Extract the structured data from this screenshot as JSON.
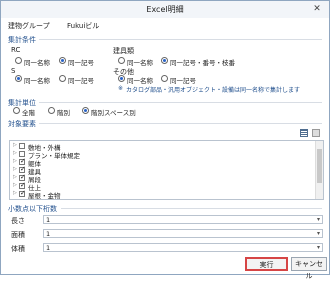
{
  "window": {
    "title": "Excel明細",
    "close_glyph": "✕"
  },
  "info": {
    "group": "建物グループ",
    "name": "Fukuiビル"
  },
  "sections": {
    "conditions": "集計条件",
    "unit": "集計単位",
    "elements": "対象要素",
    "decimals": "小数点以下桁数"
  },
  "conditions": {
    "rc": {
      "label": "RC",
      "options": [
        "同一名称",
        "同一記号"
      ],
      "selected": 1
    },
    "fitting": {
      "label": "建具類",
      "options": [
        "同一名称",
        "同一記号・番号・枝番"
      ],
      "selected": 1
    },
    "s": {
      "label": "S",
      "options": [
        "同一名称",
        "同一記号"
      ],
      "selected": 0
    },
    "other": {
      "label": "その他",
      "options": [
        "同一名称",
        "同一記号"
      ],
      "selected": 0
    },
    "note_mark": "※",
    "note": "カタログ部品・汎用オブジェクト・設備は同一名称で集計します"
  },
  "unit": {
    "options": [
      "全階",
      "階別",
      "階別スペース別"
    ],
    "selected": 2
  },
  "elements": [
    {
      "label": "敷地・外構",
      "checked": false,
      "expand": "▷"
    },
    {
      "label": "プラン・単体規定",
      "checked": false,
      "expand": "▷"
    },
    {
      "label": "躯体",
      "checked": true,
      "expand": "▷"
    },
    {
      "label": "建具",
      "checked": true,
      "expand": "▷"
    },
    {
      "label": "屑段",
      "checked": true,
      "expand": "▷"
    },
    {
      "label": "仕上",
      "checked": true,
      "expand": "▷"
    },
    {
      "label": "屋根・金物",
      "checked": true,
      "expand": "▷"
    }
  ],
  "decimals": [
    {
      "label": "長さ",
      "value": "1",
      "arrow": "▾"
    },
    {
      "label": "面積",
      "value": "1",
      "arrow": "▾"
    },
    {
      "label": "体積",
      "value": "1",
      "arrow": "▾"
    }
  ],
  "buttons": {
    "run": "実行",
    "cancel": "キャンセル"
  },
  "icons": {
    "list_view": "list-view-icon",
    "grid_view": "grid-view-icon"
  }
}
